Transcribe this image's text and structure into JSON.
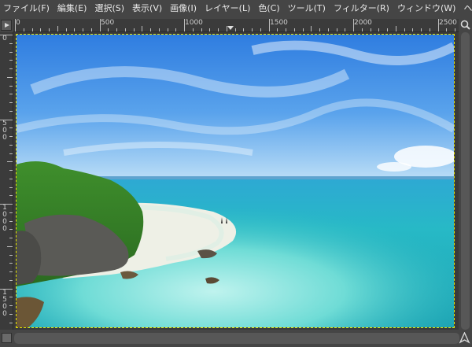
{
  "menu": [
    {
      "label": "ファイル(F)"
    },
    {
      "label": "編集(E)"
    },
    {
      "label": "選択(S)"
    },
    {
      "label": "表示(V)"
    },
    {
      "label": "画像(I)"
    },
    {
      "label": "レイヤー(L)"
    },
    {
      "label": "色(C)"
    },
    {
      "label": "ツール(T)"
    },
    {
      "label": "フィルター(R)"
    },
    {
      "label": "ウィンドウ(W)"
    },
    {
      "label": "ヘルプ(H"
    }
  ],
  "rulers": {
    "horizontal_labels": [
      "0",
      "500",
      "1000",
      "1500",
      "2000",
      "2500"
    ],
    "vertical_labels": [
      "0",
      "500",
      "1000",
      "1500"
    ]
  },
  "image": {
    "description": "Tropical beach with turquoise sea, white sand, green cliff and blue sky"
  },
  "colors": {
    "selection_outline": "#e6e600",
    "menubar_bg": "#454545"
  }
}
